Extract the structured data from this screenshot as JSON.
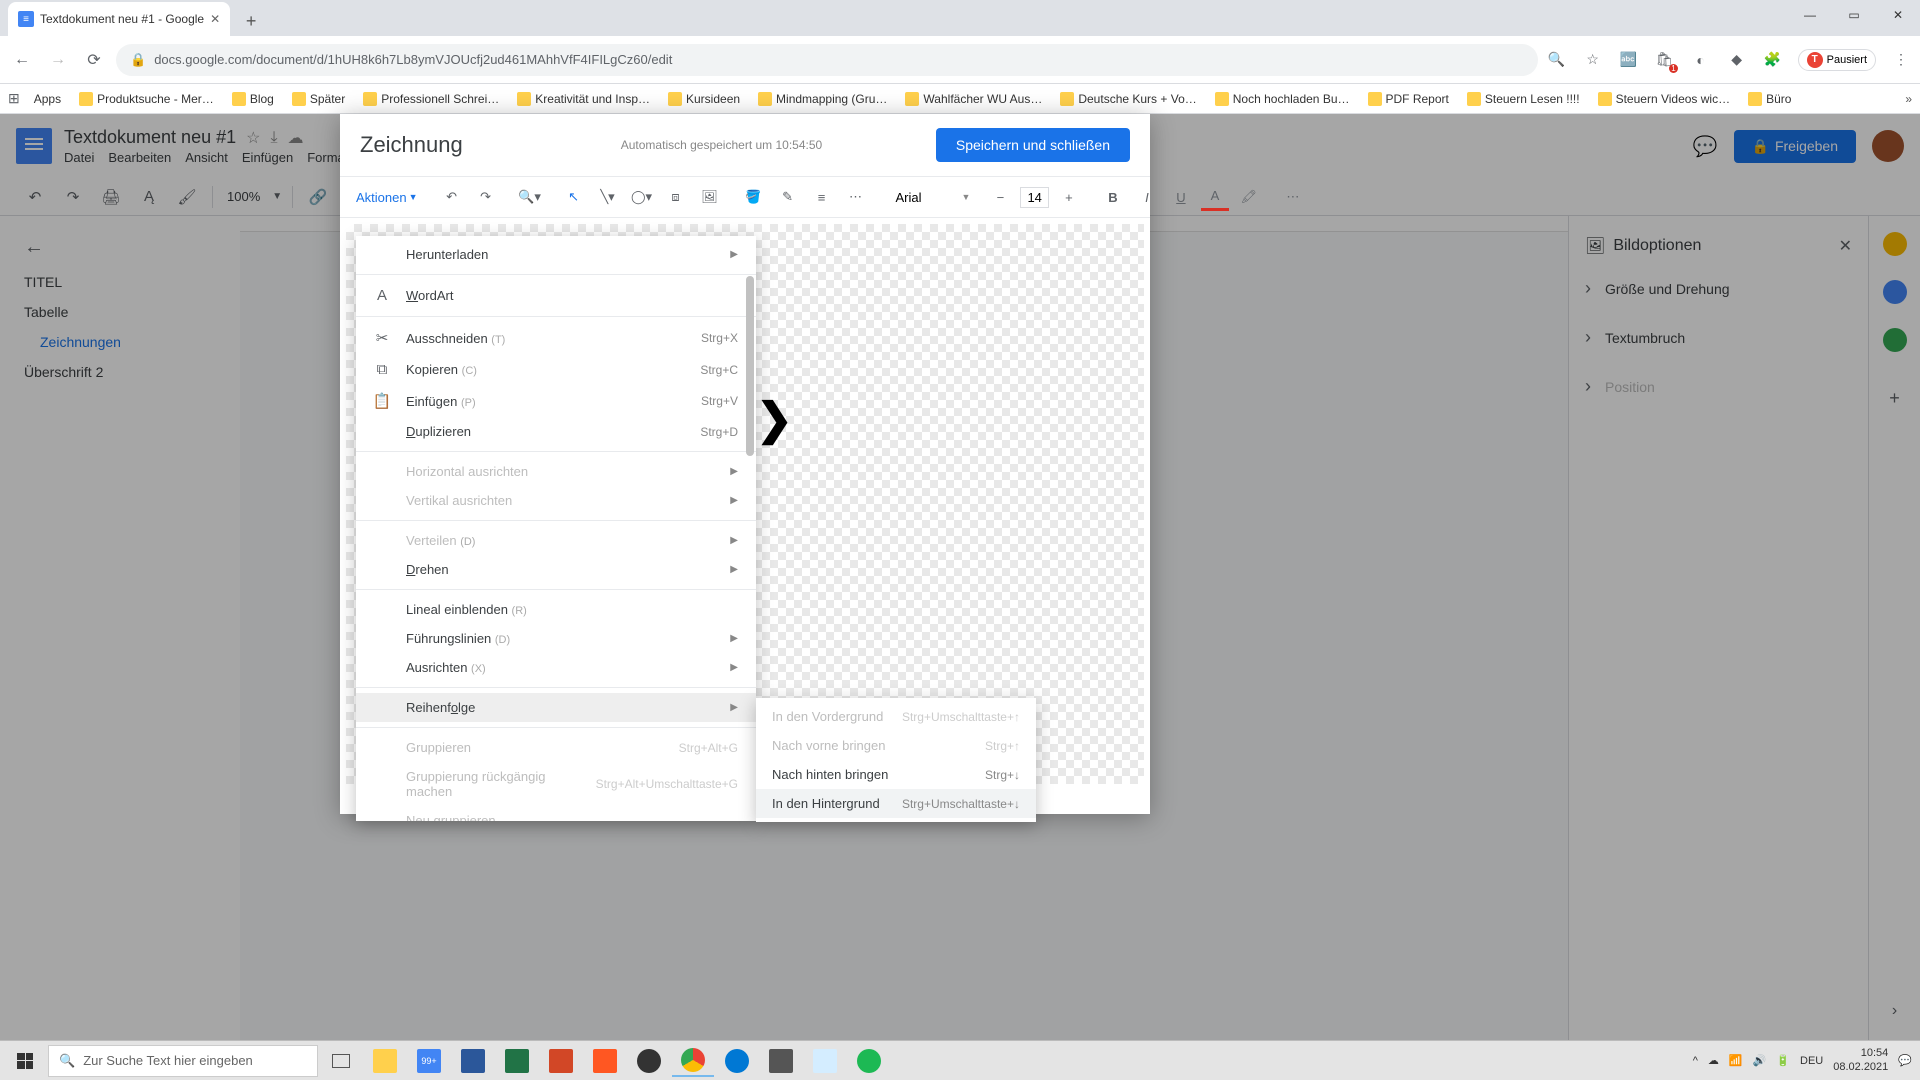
{
  "browser": {
    "tab_title": "Textdokument neu #1 - Google",
    "url": "docs.google.com/document/d/1hUH8k6h7Lb8ymVJOUcfj2ud461MAhhVfF4IFILgCz60/edit",
    "paused_label": "Pausiert"
  },
  "bookmarks": [
    "Apps",
    "Produktsuche - Mer…",
    "Blog",
    "Später",
    "Professionell Schrei…",
    "Kreativität und Insp…",
    "Kursideen",
    "Mindmapping  (Gru…",
    "Wahlfächer WU Aus…",
    "Deutsche Kurs + Vo…",
    "Noch hochladen Bu…",
    "PDF Report",
    "Steuern Lesen !!!!",
    "Steuern Videos wic…",
    "Büro"
  ],
  "docs": {
    "title": "Textdokument neu #1",
    "menus": [
      "Datei",
      "Bearbeiten",
      "Ansicht",
      "Einfügen",
      "Format"
    ],
    "zoom": "100%",
    "share": "Freigeben",
    "comments_icon": "comments"
  },
  "outline": {
    "items": [
      {
        "label": "TITEL",
        "lvl": 1
      },
      {
        "label": "Tabelle",
        "lvl": 1
      },
      {
        "label": "Zeichnungen",
        "lvl": 2,
        "selected": true
      },
      {
        "label": "Überschrift 2",
        "lvl": 1
      }
    ]
  },
  "image_options": {
    "title": "Bildoptionen",
    "rows": [
      {
        "label": "Größe und Drehung",
        "disabled": false
      },
      {
        "label": "Textumbruch",
        "disabled": false
      },
      {
        "label": "Position",
        "disabled": true
      }
    ]
  },
  "drawing": {
    "title": "Zeichnung",
    "autosave": "Automatisch gespeichert um 10:54:50",
    "save_close": "Speichern und schließen",
    "actions_label": "Aktionen",
    "font": "Arial",
    "font_size": "14"
  },
  "actions_menu": [
    {
      "type": "item",
      "label": "Herunterladen",
      "submenu": true
    },
    {
      "type": "sep"
    },
    {
      "type": "item",
      "icon": "A",
      "label": "WordArt",
      "underline_first": true
    },
    {
      "type": "sep"
    },
    {
      "type": "item",
      "icon": "✂",
      "label": "Ausschneiden",
      "hint": "(T)",
      "shortcut": "Strg+X"
    },
    {
      "type": "item",
      "icon": "⧉",
      "label": "Kopieren",
      "hint": "(C)",
      "shortcut": "Strg+C"
    },
    {
      "type": "item",
      "icon": "📋",
      "label": "Einfügen",
      "hint": "(P)",
      "shortcut": "Strg+V"
    },
    {
      "type": "item",
      "label": "Duplizieren",
      "underline_first": true,
      "shortcut": "Strg+D"
    },
    {
      "type": "sep"
    },
    {
      "type": "item",
      "label": "Horizontal ausrichten",
      "disabled": true,
      "submenu": true
    },
    {
      "type": "item",
      "label": "Vertikal ausrichten",
      "disabled": true,
      "submenu": true
    },
    {
      "type": "sep"
    },
    {
      "type": "item",
      "label": "Verteilen",
      "hint": "(D)",
      "disabled": true,
      "submenu": true
    },
    {
      "type": "item",
      "label": "Drehen",
      "underline_first": true,
      "submenu": true
    },
    {
      "type": "sep"
    },
    {
      "type": "item",
      "label": "Lineal einblenden",
      "hint": "(R)"
    },
    {
      "type": "item",
      "label": "Führungslinien",
      "hint": "(D)",
      "submenu": true
    },
    {
      "type": "item",
      "label": "Ausrichten",
      "hint": "(X)",
      "submenu": true
    },
    {
      "type": "sep"
    },
    {
      "type": "item",
      "label": "Reihenfolge",
      "underline": [
        7
      ],
      "submenu": true,
      "highlighted": true
    },
    {
      "type": "sep"
    },
    {
      "type": "item",
      "label": "Gruppieren",
      "shortcut": "Strg+Alt+G",
      "disabled": true
    },
    {
      "type": "item",
      "label": "Gruppierung rückgängig machen",
      "shortcut": "Strg+Alt+Umschalttaste+G",
      "disabled": true
    },
    {
      "type": "item",
      "label": "Neu gruppieren",
      "disabled": true
    }
  ],
  "submenu": [
    {
      "label": "In den Vordergrund",
      "shortcut": "Strg+Umschalttaste+↑",
      "disabled": true
    },
    {
      "label": "Nach vorne bringen",
      "shortcut": "Strg+↑",
      "disabled": true
    },
    {
      "label": "Nach hinten bringen",
      "shortcut": "Strg+↓"
    },
    {
      "label": "In den Hintergrund",
      "shortcut": "Strg+Umschalttaste+↓",
      "hover": true
    }
  ],
  "taskbar": {
    "search_placeholder": "Zur Suche Text hier eingeben",
    "lang": "DEU",
    "time": "10:54",
    "date": "08.02.2021"
  }
}
